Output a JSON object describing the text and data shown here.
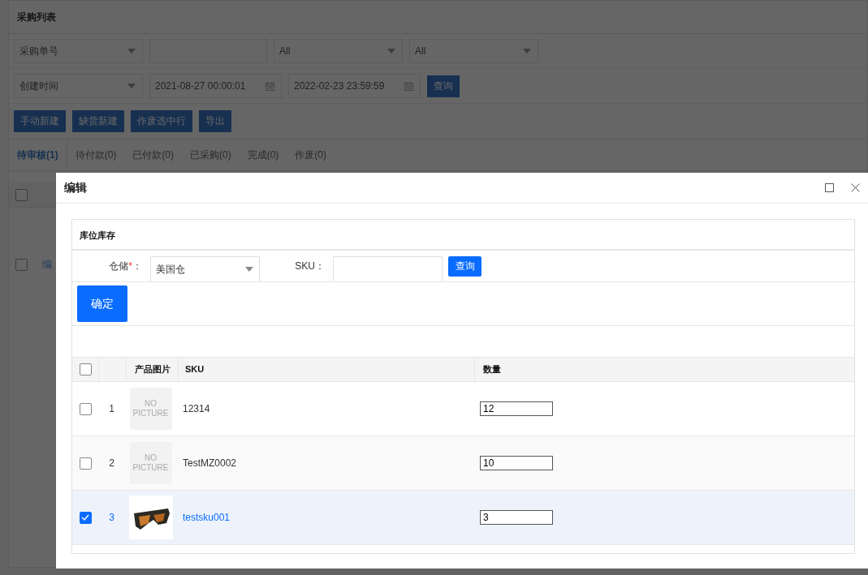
{
  "background": {
    "title": "采购列表",
    "filter_rows": [
      [
        {
          "kind": "select",
          "value": "采购单号"
        },
        {
          "kind": "input"
        },
        {
          "kind": "select",
          "value": "All"
        },
        {
          "kind": "select",
          "value": "All"
        }
      ],
      [
        {
          "kind": "select",
          "value": "创建时间"
        },
        {
          "kind": "date",
          "value": "2021-08-27 00:00:01"
        },
        {
          "kind": "date",
          "value": "2022-02-23 23:59:59"
        },
        {
          "kind": "button",
          "value": "查询"
        }
      ]
    ],
    "actions": [
      "手动新建",
      "缺货新建",
      "作废选中行",
      "导出"
    ],
    "tabs": [
      {
        "label": "待审核(1)",
        "selected": true
      },
      {
        "label": "待付款(0)",
        "selected": false
      },
      {
        "label": "已付款(0)",
        "selected": false
      },
      {
        "label": "已采购(0)",
        "selected": false
      },
      {
        "label": "完成(0)",
        "selected": false
      },
      {
        "label": "作废(0)",
        "selected": false
      }
    ],
    "table": {
      "header_checked": false,
      "rows": [
        {
          "checked": false,
          "link": "编"
        }
      ]
    }
  },
  "dialog": {
    "title": "编辑",
    "section_title": "库位库存",
    "warehouse": {
      "label": "仓储",
      "required_mark": "*",
      "suffix": "：",
      "value": "美国仓"
    },
    "sku_filter": {
      "label": "SKU："
    },
    "search_button": "查询",
    "confirm_button": "确定",
    "table": {
      "columns": [
        "产品图片",
        "SKU",
        "数量"
      ],
      "header_checked": false,
      "rows": [
        {
          "index": "1",
          "checked": false,
          "no_picture_text": "NO PICTURE",
          "sku": "12314",
          "quantity": "12"
        },
        {
          "index": "2",
          "checked": false,
          "no_picture_text": "NO PICTURE",
          "sku": "TestMZ0002",
          "quantity": "10"
        },
        {
          "index": "3",
          "checked": true,
          "sku": "testsku001",
          "quantity": "3"
        }
      ]
    }
  }
}
